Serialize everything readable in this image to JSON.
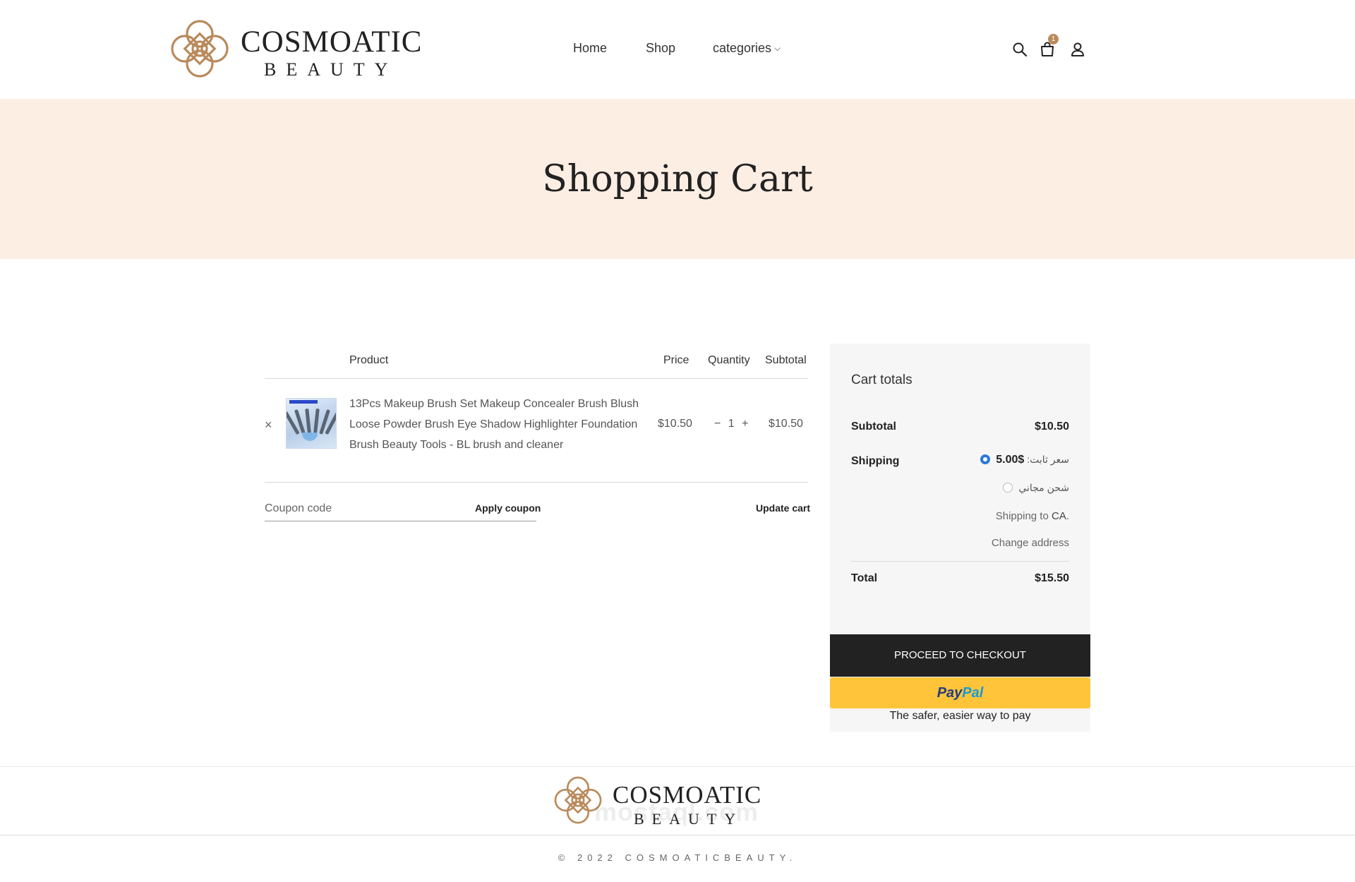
{
  "brand": {
    "name_line1": "COSMOATIC",
    "name_line2": "BEAUTY",
    "accent_color": "#b98a5c"
  },
  "nav": {
    "home": "Home",
    "shop": "Shop",
    "categories": "categories"
  },
  "header_icons": {
    "search": "search-icon",
    "cart": "cart-icon",
    "account": "user-icon",
    "cart_count": "1"
  },
  "banner": {
    "title": "Shopping Cart",
    "background": "#fdeee4"
  },
  "cart_table": {
    "headers": {
      "product": "Product",
      "price": "Price",
      "quantity": "Quantity",
      "subtotal": "Subtotal"
    },
    "items": [
      {
        "remove": "×",
        "name": "13Pcs Makeup Brush Set Makeup Concealer Brush Blush Loose Powder Brush Eye Shadow Highlighter Foundation Brush Beauty Tools - BL brush and cleaner",
        "price": "$10.50",
        "qty_minus": "−",
        "quantity": "1",
        "qty_plus": "+",
        "subtotal": "$10.50"
      }
    ],
    "coupon_placeholder": "Coupon code",
    "apply_coupon": "Apply coupon",
    "update_cart": "Update cart"
  },
  "totals": {
    "title": "Cart totals",
    "subtotal_label": "Subtotal",
    "subtotal_value": "$10.50",
    "shipping_label": "Shipping",
    "shipping_option1_label": "سعر ثابت:",
    "shipping_option1_price": "$5.00",
    "shipping_option2_label": "شحن مجاني",
    "shipping_to_prefix": "Shipping to",
    "shipping_to_region": "CA",
    "shipping_to_suffix": ".",
    "change_address": "Change address",
    "total_label": "Total",
    "total_value": "$15.50",
    "checkout": "PROCEED TO CHECKOUT",
    "paypal_1": "Pay",
    "paypal_2": "Pal",
    "paypal_tagline": "The safer, easier way to pay"
  },
  "footer": {
    "copyright": "© 2022 COSMOATICBEAUTY.",
    "watermark": "mostaql.com"
  }
}
